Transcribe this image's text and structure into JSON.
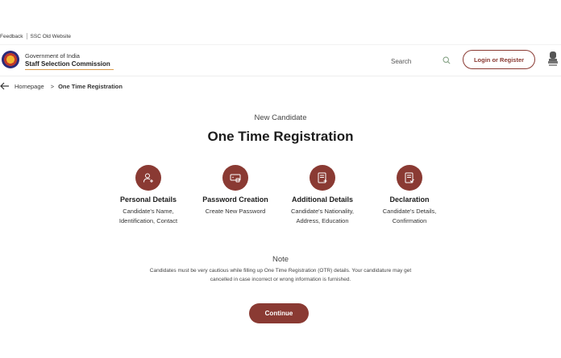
{
  "top_links": {
    "feedback": "Feedback",
    "old_website": "SSC Old Website"
  },
  "header": {
    "brand_line1": "Government of India",
    "brand_line2": "Staff Selection Commission",
    "search_placeholder": "Search",
    "login_label": "Login or Register"
  },
  "breadcrumb": {
    "home": "Homepage",
    "separator": ">",
    "current": "One Time Registration"
  },
  "page": {
    "subtitle": "New Candidate",
    "title": "One Time Registration"
  },
  "steps": [
    {
      "title": "Personal Details",
      "desc": "Candidate's Name, Identification, Contact",
      "icon": "user-add-icon"
    },
    {
      "title": "Password Creation",
      "desc": "Create New Password",
      "icon": "password-icon"
    },
    {
      "title": "Additional Details",
      "desc": "Candidate's Nationality, Address, Education",
      "icon": "document-add-icon"
    },
    {
      "title": "Declaration",
      "desc": "Candidate's Details, Confirmation",
      "icon": "document-check-icon"
    }
  ],
  "note": {
    "title": "Note",
    "text": "Candidates must be very cautious while filling up One Time Registration (OTR) details. Your candidature may get cancelled in case incorrect or wrong information is furnished."
  },
  "continue_label": "Continue",
  "colors": {
    "accent": "#8a3a33",
    "brand_line": "#d99a4a"
  }
}
